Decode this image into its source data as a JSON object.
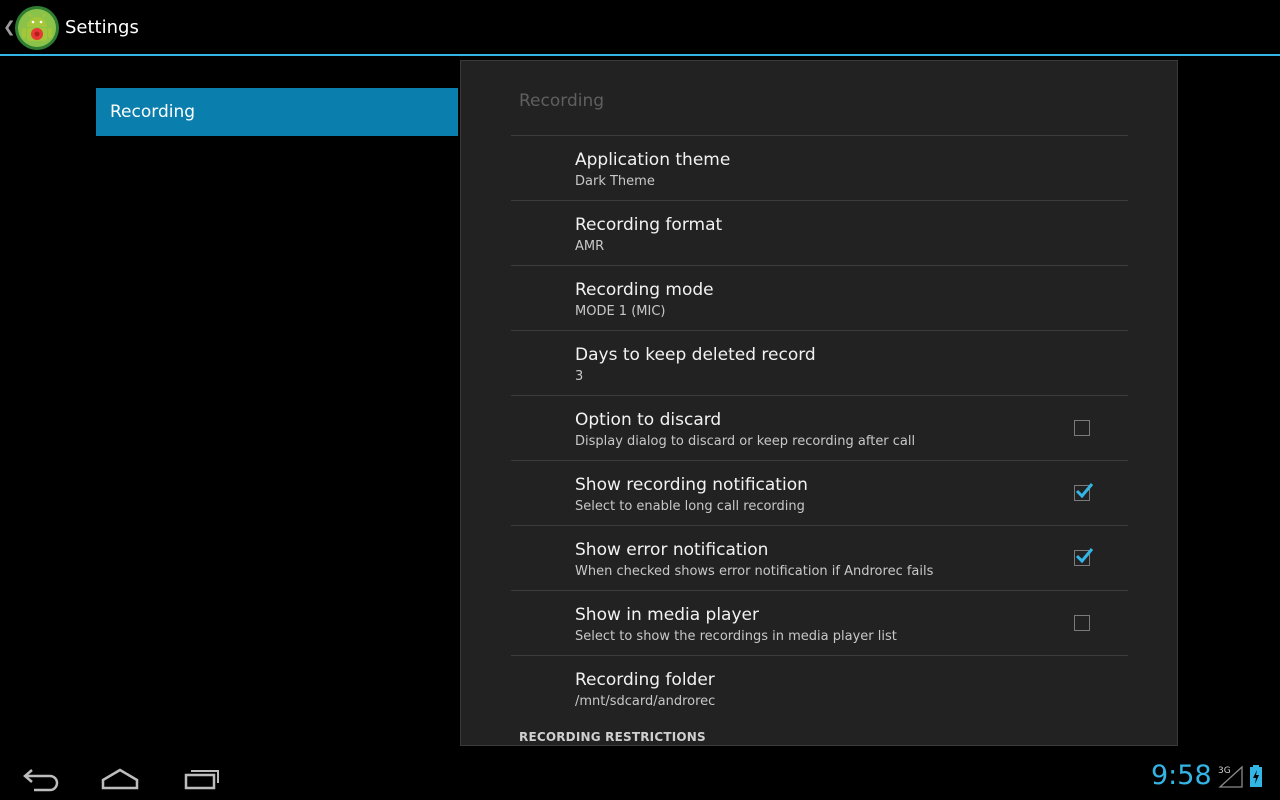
{
  "actionbar": {
    "title": "Settings",
    "app_icon": "android-recorder-icon",
    "accent": "#33b5e5"
  },
  "headers": [
    {
      "label": "Recording",
      "selected": true
    }
  ],
  "panel": {
    "category": "Recording",
    "prefs": [
      {
        "title": "Application theme",
        "summary": "Dark Theme"
      },
      {
        "title": "Recording format",
        "summary": "AMR"
      },
      {
        "title": "Recording mode",
        "summary": "MODE 1 (MIC)"
      },
      {
        "title": "Days to keep deleted record",
        "summary": "3"
      },
      {
        "title": "Option to discard",
        "summary": "Display dialog to discard or keep recording after call",
        "checked": false
      },
      {
        "title": "Show recording notification",
        "summary": "Select to enable long call recording",
        "checked": true
      },
      {
        "title": "Show error notification",
        "summary": "When checked shows error notification if Androrec fails",
        "checked": true
      },
      {
        "title": "Show in media player",
        "summary": "Select to show the recordings in media player list",
        "checked": false
      },
      {
        "title": "Recording folder",
        "summary": "/mnt/sdcard/androrec"
      }
    ],
    "next_section": "RECORDING RESTRICTIONS"
  },
  "systembar": {
    "time": "9:58",
    "network": "3G",
    "icons": [
      "back-icon",
      "home-icon",
      "recent-apps-icon",
      "signal-icon",
      "battery-icon"
    ]
  }
}
